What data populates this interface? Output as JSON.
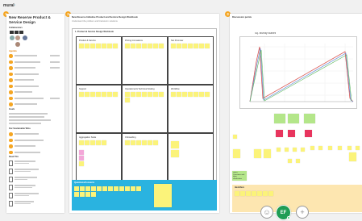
{
  "app": {
    "logo_prefix": "mural",
    "logo_suffix": "·"
  },
  "sidebar": {
    "badge": "1",
    "title": "New Reserve Product & Service Design",
    "section_collaborators": "Collaborators",
    "section_agenda": "Agenda",
    "section_goals": "Goals",
    "section_outcomes": "Our Sustainable Wins",
    "section_read_this": "Read This"
  },
  "frame2": {
    "badge": "2",
    "header": "New Reserve Initiative Product and Service Design Workbook",
    "header_sub": "Understand the problem and brainstorm solutions",
    "board_title": "1. Product & Service Design Workbook",
    "cells": [
      {
        "title": "Product & Service"
      },
      {
        "title": "Pricing Innovations"
      },
      {
        "title": "Net Promoter"
      },
      {
        "title": "Support"
      },
      {
        "title": "Operational & Technical Scaling"
      },
      {
        "title": "Workflow"
      },
      {
        "title": "Aggregation Scale"
      },
      {
        "title": "Onboarding"
      },
      {
        "title": ""
      }
    ],
    "questions_title": "Questions/Concerns"
  },
  "frame3": {
    "badge": "3",
    "header": "Discussion points",
    "chart_title": "Sq. Murray Burkes",
    "identifiers_title": "Identifiers",
    "notes_title": "Notes Questions and open clarification"
  },
  "toolbar": {
    "center_initials": "EF",
    "add_symbol": "+",
    "face_symbol": "☺"
  },
  "colors": {
    "accent_orange": "#f5a623",
    "sticky_yellow": "#fbf37a",
    "sticky_pink": "#f3a7d8",
    "blue_panel": "#2ab3e0",
    "orange_panel": "#fde6b0",
    "user_green": "#1f9d55"
  }
}
